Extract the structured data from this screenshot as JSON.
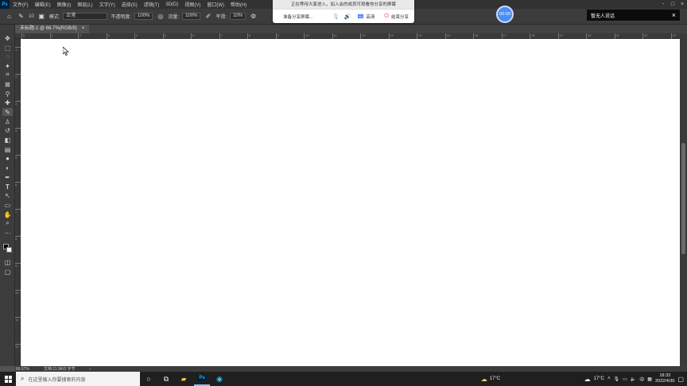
{
  "menubar": {
    "app_logo": "Ps",
    "items": [
      "文件(F)",
      "编辑(E)",
      "图像(I)",
      "图层(L)",
      "文字(Y)",
      "选择(S)",
      "滤镜(T)",
      "3D(D)",
      "视图(V)",
      "窗口(W)",
      "帮助(H)"
    ],
    "window_controls": [
      "-",
      "□",
      "×"
    ]
  },
  "options_bar": {
    "brush_size": "10",
    "mode_label": "模式:",
    "mode_value": "正常",
    "opacity_label": "不透明度:",
    "opacity_value": "100%",
    "flow_label": "流量:",
    "flow_value": "100%",
    "smoothing_label": "平滑:",
    "smoothing_value": "10%"
  },
  "document": {
    "tab_title": "未标题-1 @ 66.7%(RGB/8)",
    "tab_close": "×",
    "zoom": "66.67%",
    "doc_info": "文档:11.9K/0 字节",
    "status_arrow": "›"
  },
  "ruler": {
    "h_labels": [
      "0",
      "1",
      "2",
      "3",
      "4",
      "5",
      "6",
      "7",
      "8",
      "9",
      "10",
      "11",
      "12",
      "13",
      "14",
      "15",
      "16",
      "17",
      "18",
      "19",
      "20",
      "21",
      "22",
      "23"
    ],
    "v_labels": [
      "1",
      "2",
      "3",
      "4",
      "5",
      "6",
      "7",
      "8",
      "9",
      "10",
      "11",
      "12"
    ]
  },
  "share_panel": {
    "notice": "正在等待大家进入，加入会的成员可观看你分享的屏幕",
    "status": "准备分享屏幕...",
    "quality": "高清",
    "stop": "结束分享"
  },
  "timer": "00:00",
  "chat_panel": {
    "title": "暂无人说话",
    "close": "×"
  },
  "taskbar": {
    "search_placeholder": "在这里输入你要搜索的内容",
    "weather_left": "17°C",
    "weather_right": "17°C",
    "ime": "中",
    "time": "18:33",
    "date": "2022/4/30"
  },
  "colors": {
    "accent": "#31a8ff",
    "timer_blue": "#4a8ef2",
    "canvas": "#ffffff",
    "ui_dark": "#3c3c3c"
  }
}
